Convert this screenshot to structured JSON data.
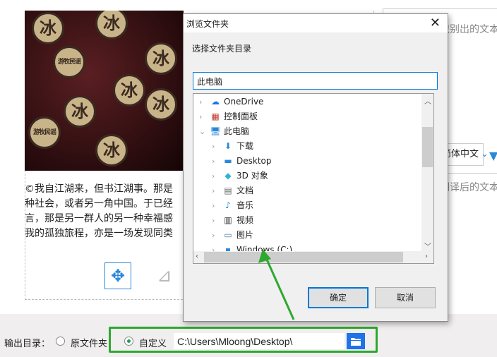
{
  "editor": {
    "paragraph": [
      "©我自江湖来，但书江湖事。那是",
      "种社会，或者另一角中国。于已经",
      "言，那是另一群人的另一种幸福感",
      "我的孤独旅程，亦是一场发现同类"
    ],
    "logo_text": "冰",
    "badge_text": "游牧民谣"
  },
  "right_panel": {
    "source_placeholder": "识别出的文本",
    "language": "简体中文",
    "target_placeholder": "翻译后的文本"
  },
  "bottom": {
    "output_label": "输出目录：",
    "option_original": "原文件夹",
    "option_custom": "自定义",
    "path_value": "C:\\Users\\Mloong\\Desktop\\",
    "selected": "custom"
  },
  "dialog": {
    "title": "浏览文件夹",
    "prompt": "选择文件夹目录",
    "current": "此电脑",
    "ok": "确定",
    "cancel": "取消",
    "tree": [
      {
        "label": "OneDrive",
        "icon": "cloud-icon",
        "level": 0,
        "expanded": false
      },
      {
        "label": "控制面板",
        "icon": "control-panel-icon",
        "level": 0,
        "expanded": false
      },
      {
        "label": "此电脑",
        "icon": "computer-icon",
        "level": 0,
        "expanded": true
      },
      {
        "label": "下载",
        "icon": "download-icon",
        "level": 1
      },
      {
        "label": "Desktop",
        "icon": "desktop-icon",
        "level": 1
      },
      {
        "label": "3D 对象",
        "icon": "cube-icon",
        "level": 1
      },
      {
        "label": "文档",
        "icon": "document-icon",
        "level": 1
      },
      {
        "label": "音乐",
        "icon": "music-icon",
        "level": 1
      },
      {
        "label": "视频",
        "icon": "video-icon",
        "level": 1
      },
      {
        "label": "图片",
        "icon": "picture-icon",
        "level": 1
      },
      {
        "label": "Windows (C:)",
        "icon": "drive-icon",
        "level": 1
      }
    ]
  },
  "colors": {
    "accent": "#0078d7",
    "highlight": "#2ea82e",
    "folder_button": "#1e73e8"
  }
}
